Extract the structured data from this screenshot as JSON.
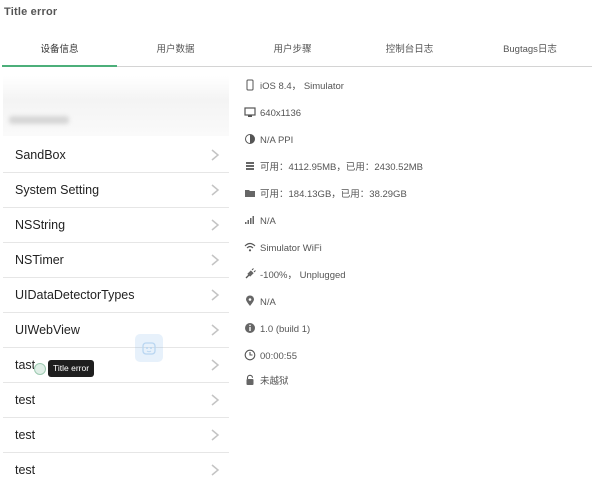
{
  "title": "Title error",
  "tabs": [
    {
      "label": "设备信息",
      "active": true
    },
    {
      "label": "用户数据",
      "active": false
    },
    {
      "label": "用户步骤",
      "active": false
    },
    {
      "label": "控制台日志",
      "active": false
    },
    {
      "label": "Bugtags日志",
      "active": false
    }
  ],
  "list_items": [
    {
      "label": "SandBox"
    },
    {
      "label": "System Setting"
    },
    {
      "label": "NSString"
    },
    {
      "label": "NSTimer"
    },
    {
      "label": "UIDataDetectorTypes"
    },
    {
      "label": "UIWebView"
    },
    {
      "label": "tast"
    },
    {
      "label": "test"
    },
    {
      "label": "test"
    },
    {
      "label": "test"
    }
  ],
  "tooltip": "Title error",
  "device_info": [
    {
      "icon": "phone-icon",
      "text": "iOS 8.4， Simulator"
    },
    {
      "icon": "monitor-icon",
      "text": "640x1136"
    },
    {
      "icon": "half-circle-icon",
      "text": "N/A PPI"
    },
    {
      "icon": "memory-icon",
      "text": "可用：4112.95MB，已用：2430.52MB"
    },
    {
      "icon": "folder-icon",
      "text": "可用：184.13GB，已用：38.29GB"
    },
    {
      "icon": "signal-icon",
      "text": "N/A"
    },
    {
      "icon": "wifi-icon",
      "text": "Simulator WiFi"
    },
    {
      "icon": "plug-icon",
      "text": "-100%， Unplugged"
    },
    {
      "icon": "location-pin-icon",
      "text": "N/A"
    },
    {
      "icon": "info-icon",
      "text": "1.0 (build 1)"
    },
    {
      "icon": "clock-icon",
      "text": "00:00:55"
    },
    {
      "icon": "lock-icon",
      "text": "未越狱"
    }
  ],
  "colors": {
    "active_tab_underline": "#4caf7a",
    "tooltip_bg": "#1e1e1e"
  }
}
